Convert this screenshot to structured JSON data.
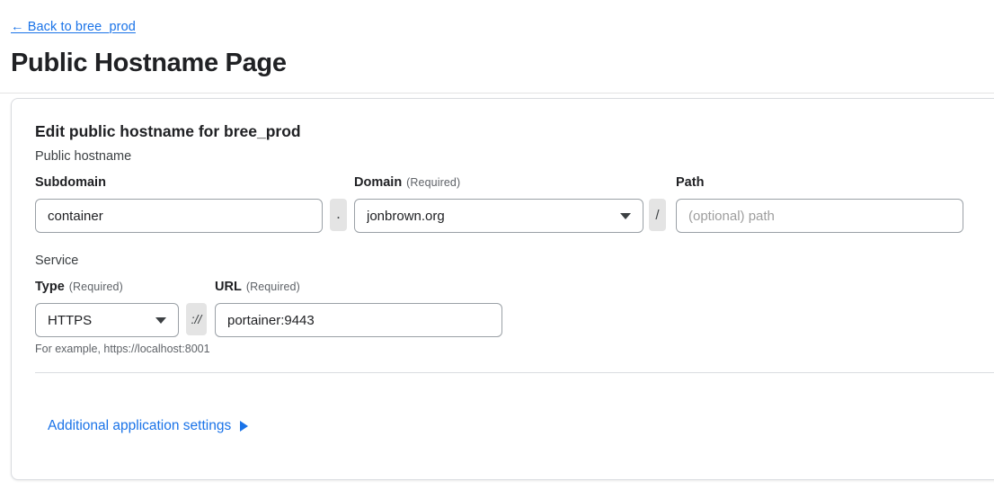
{
  "header": {
    "back_link": "← Back to bree_prod",
    "page_title": "Public Hostname Page"
  },
  "card": {
    "title": "Edit public hostname for bree_prod",
    "sections": {
      "hostname_label": "Public hostname",
      "service_label": "Service"
    },
    "hostname_row": {
      "subdomain": {
        "label": "Subdomain",
        "required_note": "",
        "value": "container",
        "placeholder": ""
      },
      "separator_dot": ".",
      "domain": {
        "label": "Domain",
        "required_note": "(Required)",
        "value": "jonbrown.org",
        "options": [
          "jonbrown.org"
        ]
      },
      "separator_slash": "/",
      "path": {
        "label": "Path",
        "required_note": "",
        "value": "",
        "placeholder": "(optional) path"
      }
    },
    "service_row": {
      "type": {
        "label": "Type",
        "required_note": "(Required)",
        "value": "HTTPS",
        "options": [
          "HTTPS"
        ]
      },
      "separator_scheme": "://",
      "url": {
        "label": "URL",
        "required_note": "(Required)",
        "value": "portainer:9443",
        "placeholder": ""
      },
      "hint": "For example, https://localhost:8001"
    },
    "additional_settings_link": "Additional application settings"
  },
  "colors": {
    "link": "#1a73e8",
    "text": "#202124",
    "muted": "#5f6368",
    "border": "#9aa0a6",
    "chip_bg": "#e4e4e4",
    "card_border": "#dadce0"
  }
}
